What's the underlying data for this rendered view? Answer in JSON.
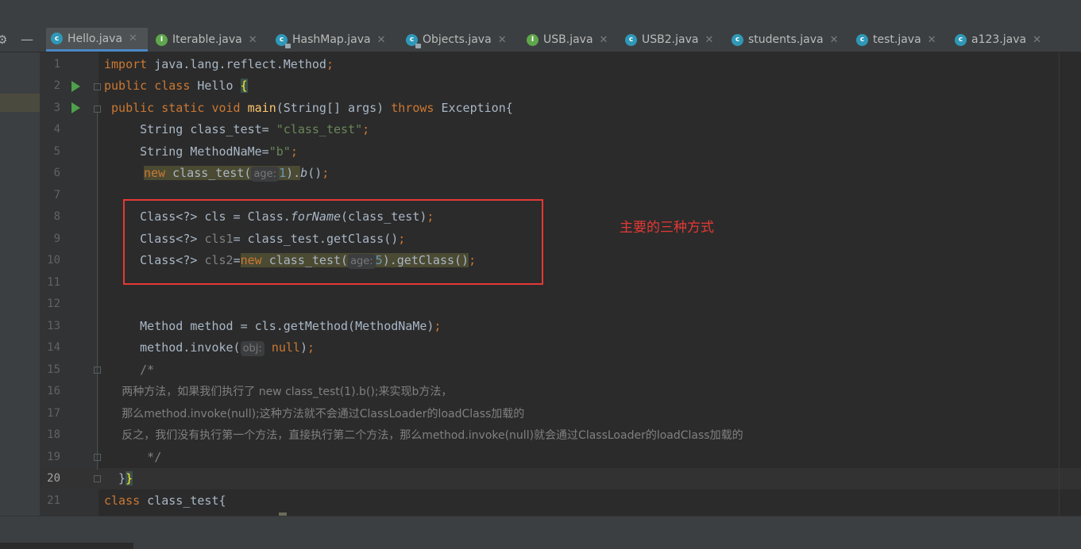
{
  "tabs": [
    {
      "label": "Hello.java",
      "icon": "class-c-icon",
      "kind": "c",
      "active": true
    },
    {
      "label": "Iterable.java",
      "icon": "interface-i-icon",
      "kind": "i"
    },
    {
      "label": "HashMap.java",
      "icon": "class-c-icon",
      "kind": "c",
      "locked": true
    },
    {
      "label": "Objects.java",
      "icon": "class-c-icon",
      "kind": "c",
      "locked": true
    },
    {
      "label": "USB.java",
      "icon": "interface-i-icon",
      "kind": "i"
    },
    {
      "label": "USB2.java",
      "icon": "class-c-icon",
      "kind": "c"
    },
    {
      "label": "students.java",
      "icon": "class-c-icon",
      "kind": "c"
    },
    {
      "label": "test.java",
      "icon": "class-c-icon",
      "kind": "c"
    },
    {
      "label": "a123.java",
      "icon": "class-c-icon",
      "kind": "c"
    }
  ],
  "tab_close": "✕",
  "editor": {
    "current_line": "20",
    "annotation": "主要的三种方式",
    "lines": {
      "l1": "import",
      "l1b": " java.lang.reflect.Method",
      "l1c": ";",
      "l2": "public class",
      "l2b": " Hello ",
      "l2c": "{",
      "l3": " public static void",
      "l3b": " main",
      "l3c": "(String[] args) ",
      "l3d": "throws",
      "l3e": " Exception{",
      "l4": "     String class_test= ",
      "l4b": "\"class_test\"",
      "l4c": ";",
      "l5": "     String MethodNaMe=",
      "l5b": "\"b\"",
      "l5c": ";",
      "l6": "new",
      "l6b": " class_test(",
      "l6h": "age:",
      "l6n": "1",
      ").b": ").",
      "l6f": "b",
      "l6c": "()",
      "l6e": ";",
      "l8": "     Class<?> cls = Class.",
      "l8f": "forName",
      "l8c": "(class_test)",
      "l8e": ";",
      "l9": "     Class<?> ",
      "l9g": "cls1",
      "l9c": "= class_test.getClass()",
      "l9e": ";",
      "l10": "     Class<?> ",
      "l10g": "cls2",
      "l10c": "=",
      "l10k": "new",
      "l10b": " class_test(",
      "l10h": "age:",
      "l10n": "5",
      "l10d": ").getClass()",
      "l10e": ";",
      "l13": "     Method method = cls.getMethod(MethodNaMe)",
      "l13e": ";",
      "l14": "     method.invoke(",
      "l14h": "obj:",
      "l14k": "null",
      "l14c": ")",
      "l14e": ";",
      "l15": "     /*",
      "l16": "     两种方法，如果我们执行了 new class_test(1).b();来实现b方法，",
      "l17": "     那么method.invoke(null);这种方法就不会通过ClassLoader的loadClass加载的",
      "l18": "     反之，我们没有执行第一个方法，直接执行第二个方法，那么method.invoke(null)就会通过ClassLoader的loadClass加载的",
      "l19": "      */",
      "l20a": "  }",
      "l20b": "}",
      "l21": "class",
      "l21b": " class_test{"
    }
  },
  "line_numbers": [
    "1",
    "2",
    "3",
    "4",
    "5",
    "6",
    "7",
    "8",
    "9",
    "10",
    "11",
    "12",
    "13",
    "14",
    "15",
    "16",
    "17",
    "18",
    "19",
    "20",
    "21"
  ]
}
